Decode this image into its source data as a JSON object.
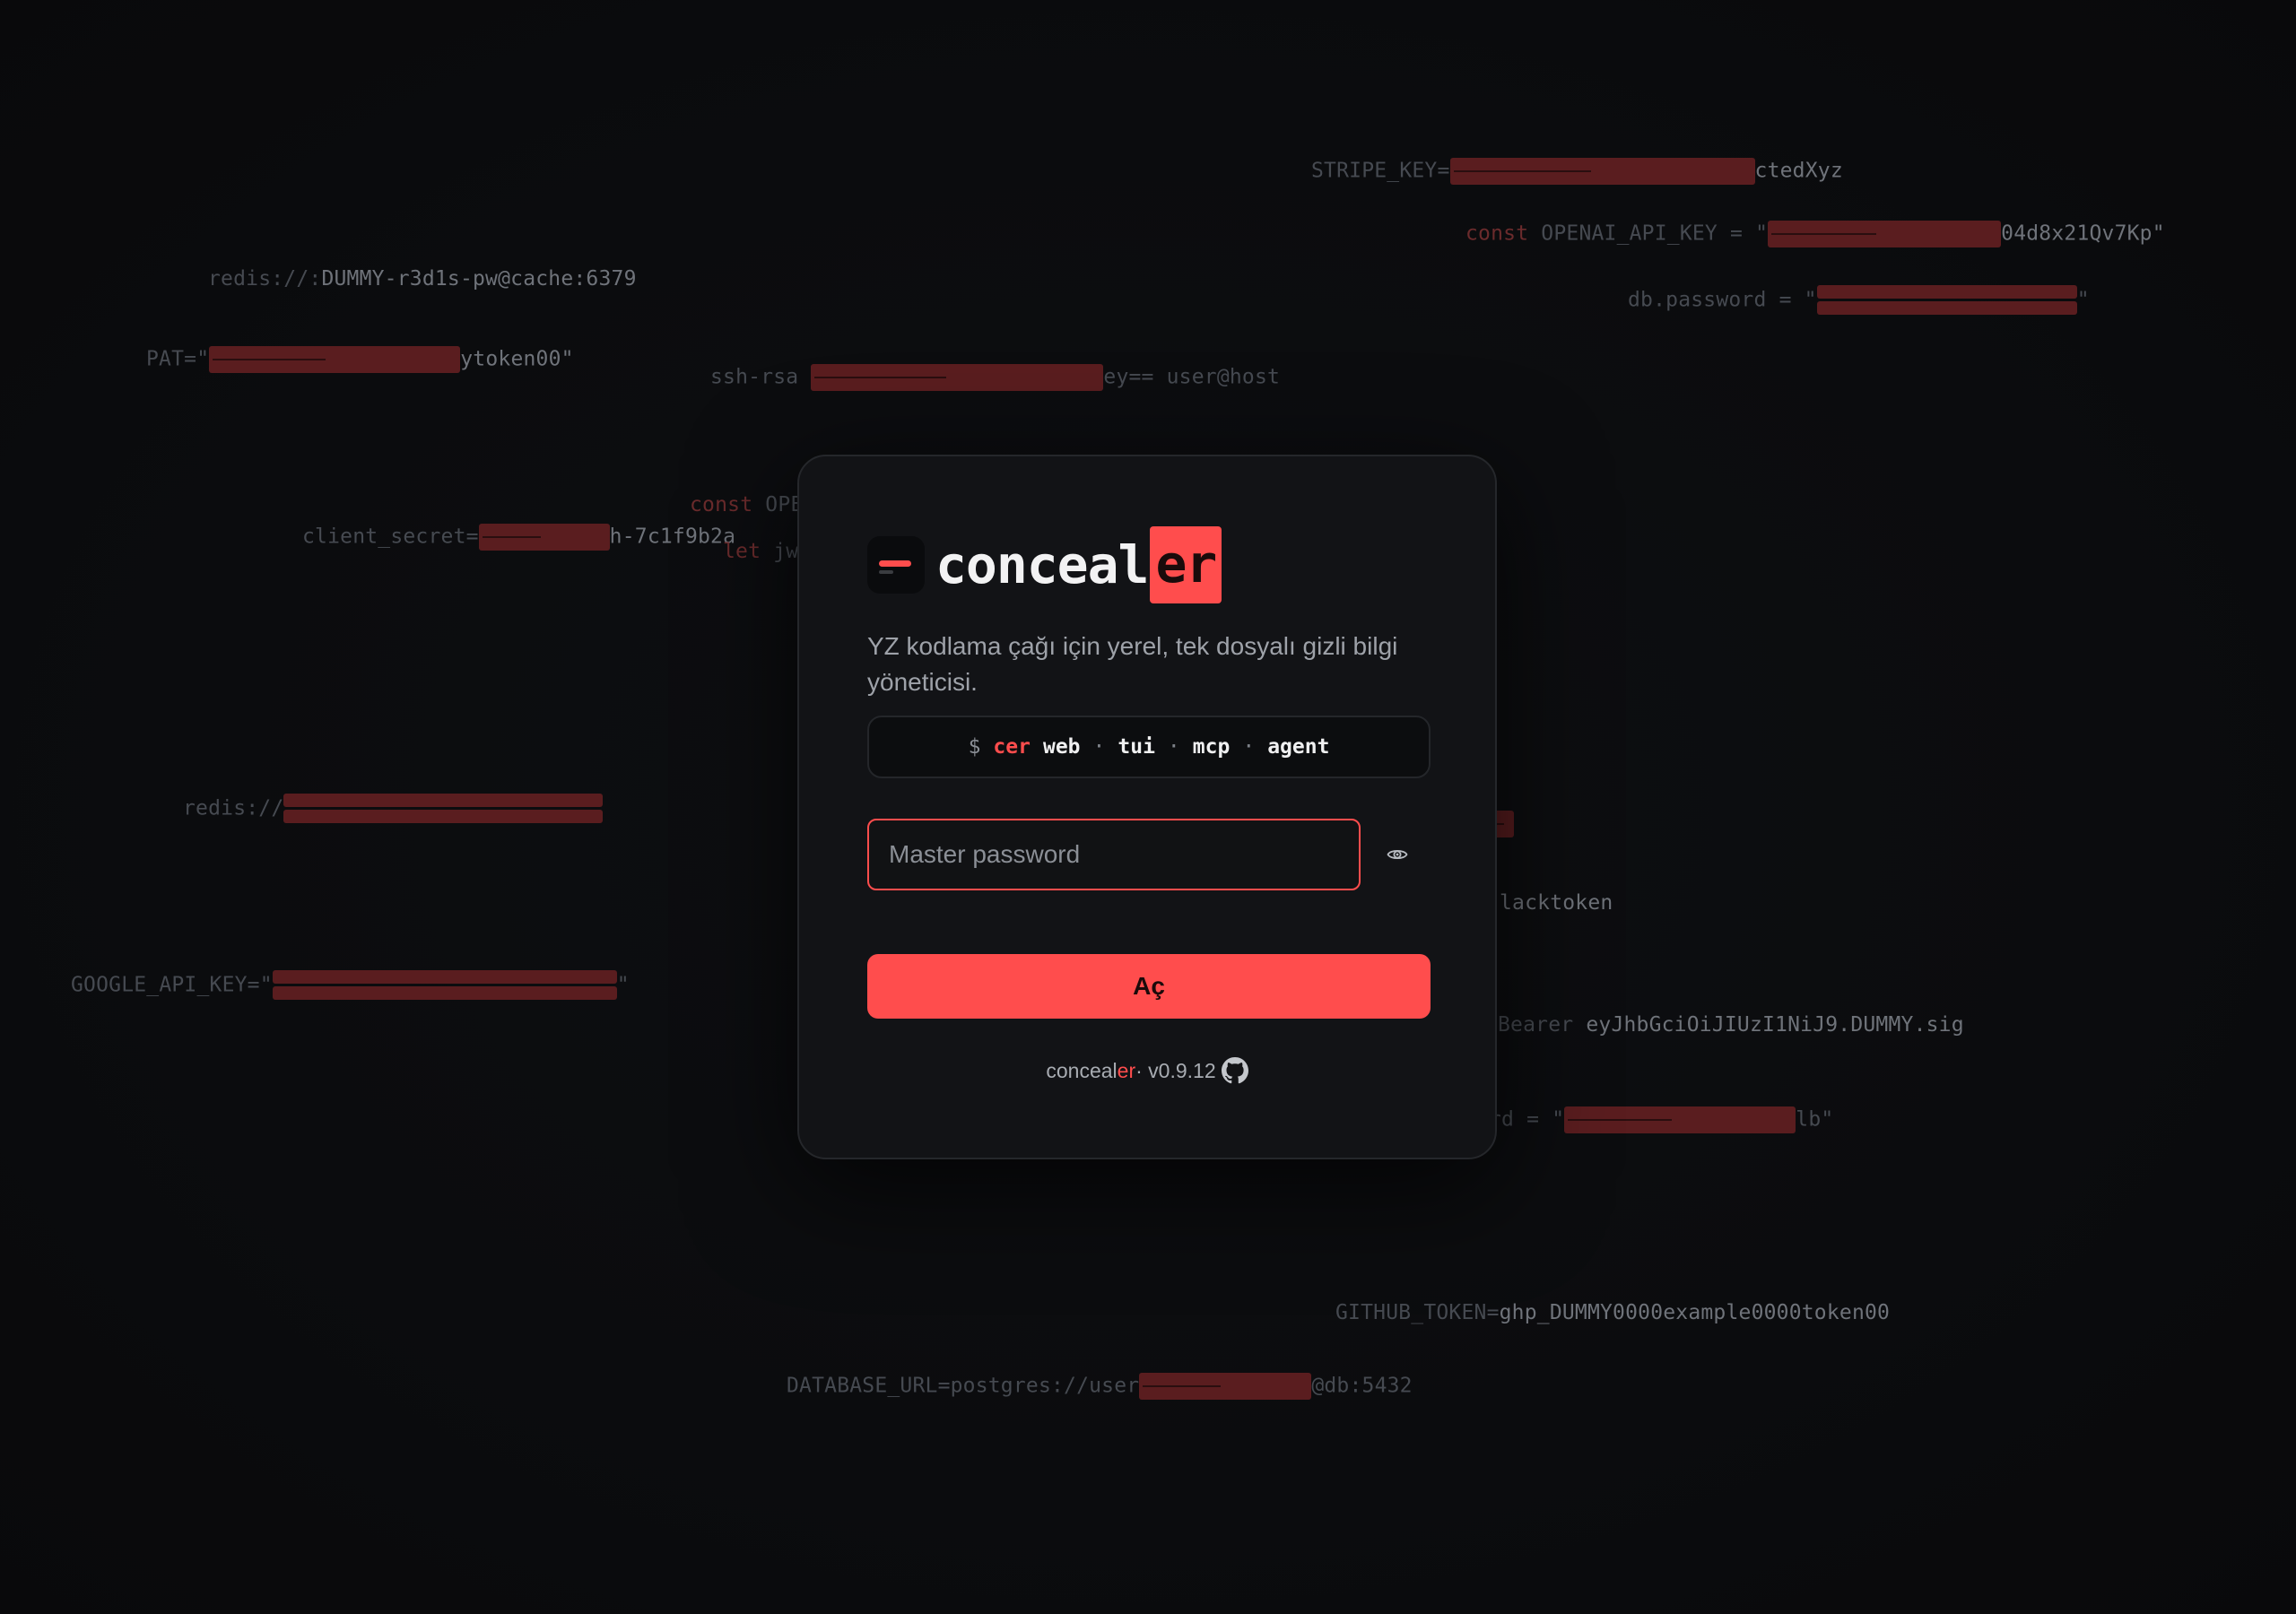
{
  "background": {
    "lines": [
      {
        "id": "stripe",
        "kw": "",
        "label": "STRIPE_KEY=",
        "redact": "single",
        "after": "ctedXyz"
      },
      {
        "id": "openai",
        "kw": "const",
        "label": " OPENAI_API_KEY = \"",
        "redact": "single",
        "after": "04d8x21Qv7Kp\""
      },
      {
        "id": "redis1",
        "kw": "",
        "label": "redis://:",
        "redact": "",
        "after": "DUMMY-r3d1s-pw@cache:6379"
      },
      {
        "id": "dbpass",
        "kw": "",
        "label": "db.password = \"",
        "redact": "double",
        "after": "\""
      },
      {
        "id": "pat",
        "kw": "",
        "label": "PAT=\"",
        "redact": "single",
        "after": "ytoken00\""
      },
      {
        "id": "sshrsa",
        "kw": "",
        "label": "ssh-rsa ",
        "redact": "single",
        "after": "ey== user@host"
      },
      {
        "id": "constope",
        "kw": "const",
        "label": " OPE",
        "redact": "",
        "after": ""
      },
      {
        "id": "clientsecret",
        "kw": "",
        "label": "client_secret=",
        "redact": "single",
        "after": "h-7c1f9b2a"
      },
      {
        "id": "letjw",
        "kw": "let",
        "label": " jw",
        "redact": "",
        "after": ""
      },
      {
        "id": "redis2",
        "kw": "",
        "label": "redis://",
        "redact": "double",
        "after": ""
      },
      {
        "id": "slack",
        "kw": "",
        "label": "",
        "redact": "",
        "after": "lacktoken"
      },
      {
        "id": "google",
        "kw": "",
        "label": "GOOGLE_API_KEY=\"",
        "redact": "double",
        "after": "\""
      },
      {
        "id": "bearer",
        "kw": "",
        "label": "Bearer ",
        "redact": "",
        "after": "eyJhbGciOiJIUzI1NiJ9.DUMMY.sig"
      },
      {
        "id": "rdpass",
        "kw": "",
        "label": "rd = \"",
        "redact": "single",
        "after": "lb\""
      },
      {
        "id": "github",
        "kw": "",
        "label": "GITHUB_TOKEN=",
        "redact": "",
        "after": "ghp_DUMMY0000example0000token00"
      },
      {
        "id": "dburl",
        "kw": "",
        "label": "DATABASE_URL=postgres://user",
        "redact": "single",
        "after": "@db:5432"
      }
    ]
  },
  "brand": {
    "icon": "concealer-logo-icon",
    "name_main": "conceal",
    "name_suffix": "er"
  },
  "tagline": "YZ kodlama çağı için yerel, tek dosyalı gizli bilgi yöneticisi.",
  "command": {
    "prompt": "$",
    "name": "cer",
    "subcommands": [
      "web",
      "tui",
      "mcp",
      "agent"
    ],
    "separator": "·"
  },
  "password": {
    "placeholder": "Master password",
    "value": "",
    "toggle_icon": "eye-icon"
  },
  "open_button": {
    "label": "Aç"
  },
  "footer": {
    "name_main": "conceal",
    "name_suffix": "er",
    "version": " · v0.9.12",
    "icon": "github-icon"
  },
  "colors": {
    "accent": "#ff4d4d",
    "background": "#0b0c0e",
    "card": "#121316",
    "redaction": "#5a1d1f"
  }
}
